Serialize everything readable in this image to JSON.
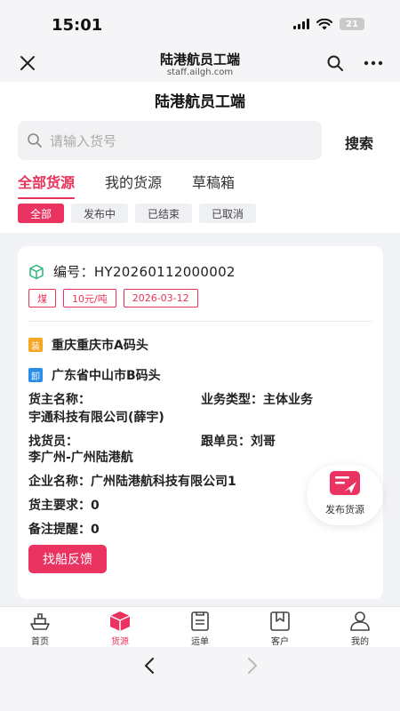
{
  "status": {
    "time": "15:01",
    "battery": "21"
  },
  "browser": {
    "title": "陆港航员工端",
    "url": "staff.ailgh.com"
  },
  "app": {
    "title": "陆港航员工端",
    "search_placeholder": "请输入货号",
    "search_button": "搜索",
    "tabs": [
      {
        "label": "全部货源",
        "active": true
      },
      {
        "label": "我的货源",
        "active": false
      },
      {
        "label": "草稿箱",
        "active": false
      }
    ],
    "filters": [
      {
        "label": "全部",
        "active": true
      },
      {
        "label": "发布中",
        "active": false
      },
      {
        "label": "已结束",
        "active": false
      },
      {
        "label": "已取消",
        "active": false
      }
    ]
  },
  "card": {
    "order_label": "编号：",
    "order_no": "HY20260112000002",
    "tags": [
      "煤",
      "10元/吨",
      "2026-03-12"
    ],
    "load_badge": "装",
    "load_place": "重庆重庆市A码头",
    "unload_badge": "卸",
    "unload_place": "广东省中山市B码头",
    "shipper_label": "货主名称：",
    "shipper_value": "宇通科技有限公司(薛宇)",
    "biz_label": "业务类型：",
    "biz_value": "主体业务",
    "finder_label": "找货员：",
    "finder_value": "李广州-广州陆港航",
    "follower_label": "跟单员：",
    "follower_value": "刘哥",
    "company_label": "企业名称：",
    "company_value": "广州陆港航科技有限公司1",
    "req_label": "货主要求：",
    "req_value": "0",
    "remark_label": "备注提醒：",
    "remark_value": "0",
    "feedback_button": "找船反馈"
  },
  "fab": {
    "label": "发布货源"
  },
  "nav": [
    {
      "label": "首页",
      "icon": "ship-icon",
      "active": false
    },
    {
      "label": "货源",
      "icon": "box-icon",
      "active": true
    },
    {
      "label": "运单",
      "icon": "waybill-icon",
      "active": false
    },
    {
      "label": "客户",
      "icon": "bookmark-icon",
      "active": false
    },
    {
      "label": "我的",
      "icon": "user-icon",
      "active": false
    }
  ],
  "colors": {
    "accent": "#ea3361",
    "load_badge": "#f5a623",
    "unload_badge": "#2a8de8",
    "box_icon": "#2fb37a"
  }
}
